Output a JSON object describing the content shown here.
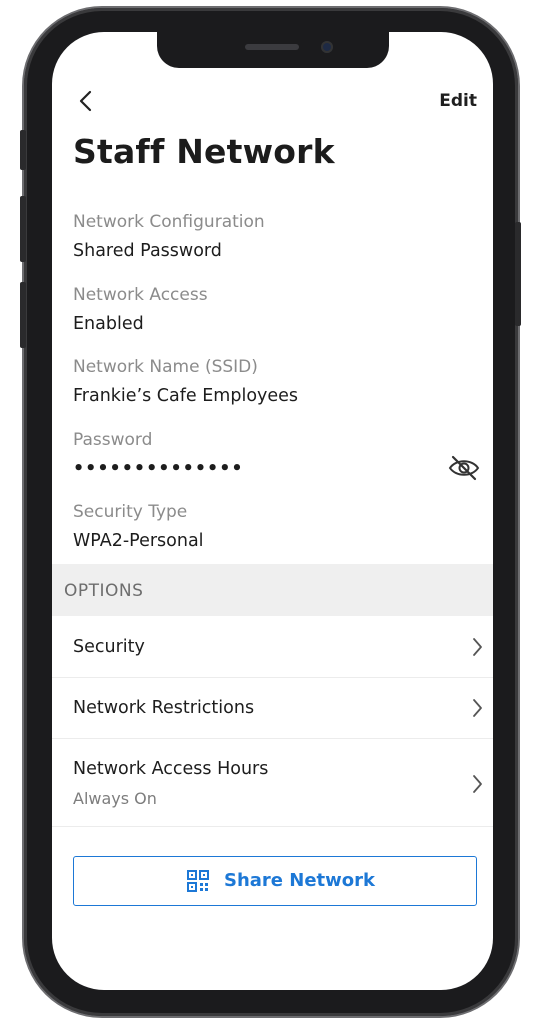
{
  "header": {
    "back_icon": "chevron-left-icon",
    "edit_label": "Edit",
    "title": "Staff Network"
  },
  "fields": [
    {
      "label": "Network Configuration",
      "value": "Shared Password"
    },
    {
      "label": "Network Access",
      "value": "Enabled"
    },
    {
      "label": "Network Name (SSID)",
      "value": "Frankie’s Cafe Employees"
    },
    {
      "label": "Password",
      "value": "••••••••••••••",
      "icon": "eye-off-icon"
    },
    {
      "label": "Security Type",
      "value": "WPA2-Personal"
    }
  ],
  "options": {
    "heading": "OPTIONS",
    "items": [
      {
        "label": "Security"
      },
      {
        "label": "Network Restrictions"
      },
      {
        "label": "Network Access Hours",
        "sublabel": "Always On"
      }
    ]
  },
  "share_button": {
    "label": "Share Network",
    "icon": "qr-code-icon"
  },
  "colors": {
    "accent": "#1d78d6",
    "label_gray": "#8b8b8b",
    "options_bg": "#efefef",
    "frame": "#1b1b1d"
  }
}
